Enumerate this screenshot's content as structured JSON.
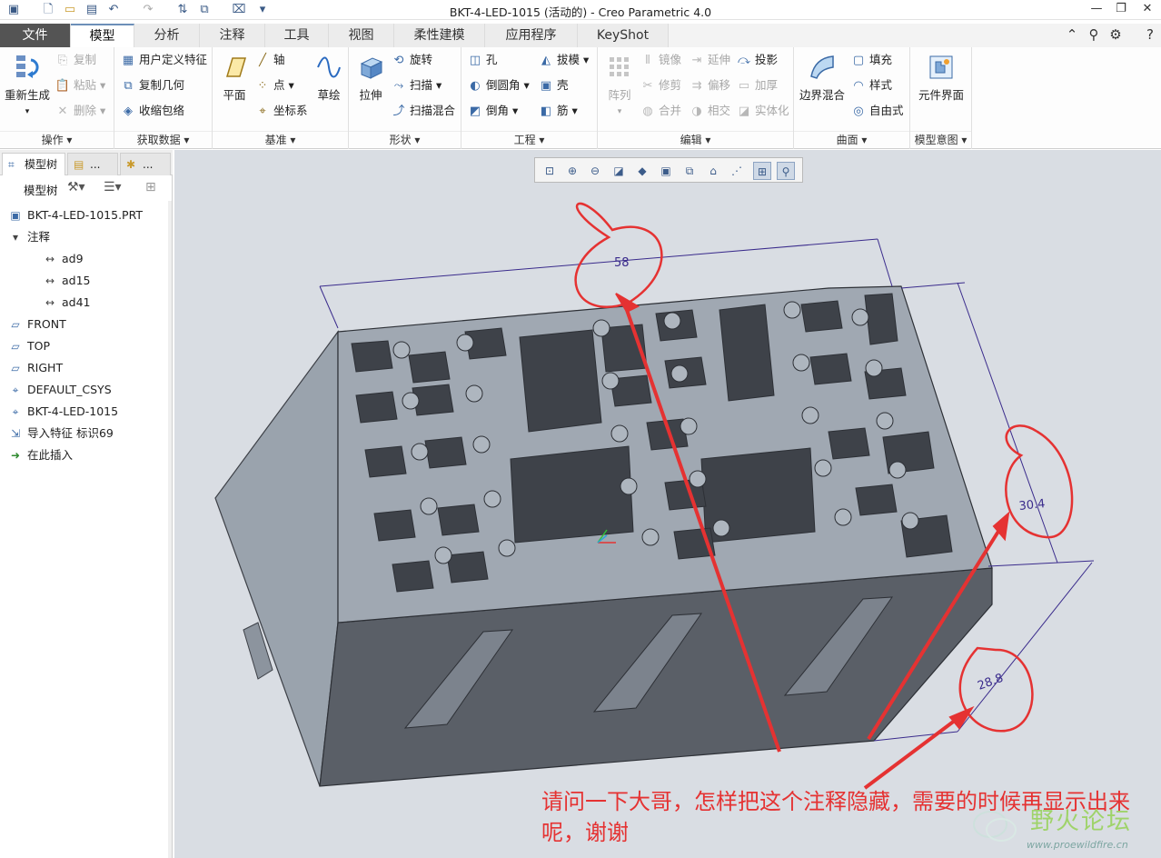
{
  "window": {
    "title": "BKT-4-LED-1015 (活动的) - Creo Parametric 4.0",
    "quick_access": [
      "app-icon",
      "new-icon",
      "open-icon",
      "save-icon",
      "undo-icon",
      "redo-icon",
      "regenerate-icon",
      "windows-icon",
      "close-window-icon",
      "customize-icon"
    ],
    "controls": {
      "minimize": "—",
      "restore": "❐",
      "close": "✕"
    }
  },
  "tabs": [
    "文件",
    "模型",
    "分析",
    "注释",
    "工具",
    "视图",
    "柔性建模",
    "应用程序",
    "KeyShot"
  ],
  "active_tab": "模型",
  "ribbon": {
    "operations": {
      "label": "操作",
      "regenerate": "重新生成",
      "copy": "复制",
      "paste": "粘贴",
      "delete": "删除"
    },
    "get_data": {
      "label": "获取数据",
      "udf": "用户定义特征",
      "copy_geom": "复制几何",
      "shrinkwrap": "收缩包络"
    },
    "datum": {
      "label": "基准",
      "plane": "平面",
      "axis": "轴",
      "point": "点",
      "csys": "坐标系",
      "sketch": "草绘"
    },
    "shapes": {
      "label": "形状",
      "extrude": "拉伸",
      "revolve": "旋转",
      "sweep": "扫描",
      "swept_blend": "扫描混合"
    },
    "engineering": {
      "label": "工程",
      "hole": "孔",
      "round": "倒圆角",
      "chamfer": "倒角",
      "draft": "拔模",
      "shell": "壳",
      "rib": "筋"
    },
    "editing": {
      "label": "编辑",
      "pattern": "阵列",
      "mirror": "镜像",
      "extend": "延伸",
      "project": "投影",
      "trim": "修剪",
      "offset": "偏移",
      "thicken": "加厚",
      "merge": "合并",
      "intersect": "相交",
      "solidify": "实体化"
    },
    "surfaces": {
      "label": "曲面",
      "boundary_blend": "边界混合",
      "fill": "填充",
      "style": "样式",
      "freestyle": "自由式"
    },
    "model_intent": {
      "label": "模型意图",
      "component_interface": "元件界面"
    }
  },
  "left_panel": {
    "tabs": [
      "模型树",
      "...",
      "..."
    ],
    "toolbar_label": "模型树",
    "tree": [
      {
        "label": "BKT-4-LED-1015.PRT",
        "icon": "part-icon",
        "level": 0
      },
      {
        "label": "注释",
        "icon": "expand-arrow-icon",
        "level": 0
      },
      {
        "label": "ad9",
        "icon": "dimension-icon",
        "level": 1
      },
      {
        "label": "ad15",
        "icon": "dimension-icon",
        "level": 1
      },
      {
        "label": "ad41",
        "icon": "dimension-icon",
        "level": 1
      },
      {
        "label": "FRONT",
        "icon": "datum-plane-icon",
        "level": 0
      },
      {
        "label": "TOP",
        "icon": "datum-plane-icon",
        "level": 0
      },
      {
        "label": "RIGHT",
        "icon": "datum-plane-icon",
        "level": 0
      },
      {
        "label": "DEFAULT_CSYS",
        "icon": "csys-icon",
        "level": 0
      },
      {
        "label": "BKT-4-LED-1015",
        "icon": "csys-icon",
        "level": 0
      },
      {
        "label": "导入特征 标识69",
        "icon": "import-feature-icon",
        "level": 0
      },
      {
        "label": "在此插入",
        "icon": "insert-here-arrow-icon",
        "level": 0
      }
    ]
  },
  "view_toolbar": [
    "refit-icon",
    "zoom-in-icon",
    "zoom-out-icon",
    "repaint-icon",
    "display-style-icon",
    "saved-views-icon",
    "view-manager-icon",
    "perspective-icon",
    "datum-display-icon",
    "annotation-display-icon",
    "spin-center-icon"
  ],
  "annotations": {
    "dim_58": "58",
    "dim_30_4": "30.4",
    "dim_28_8": "28.8"
  },
  "question": "请问一下大哥，怎样把这个注释隐藏，需要的时候再显示出来呢，谢谢",
  "watermark": {
    "title": "野火论坛",
    "url": "www.proewildfire.cn"
  },
  "colors": {
    "file_tab": "#545454",
    "accent": "#6c8fb8",
    "markup_red": "#e53232",
    "model_top": "#9aa3ad",
    "model_side": "#5a5f67",
    "dimension_line": "#3a2b8c"
  }
}
